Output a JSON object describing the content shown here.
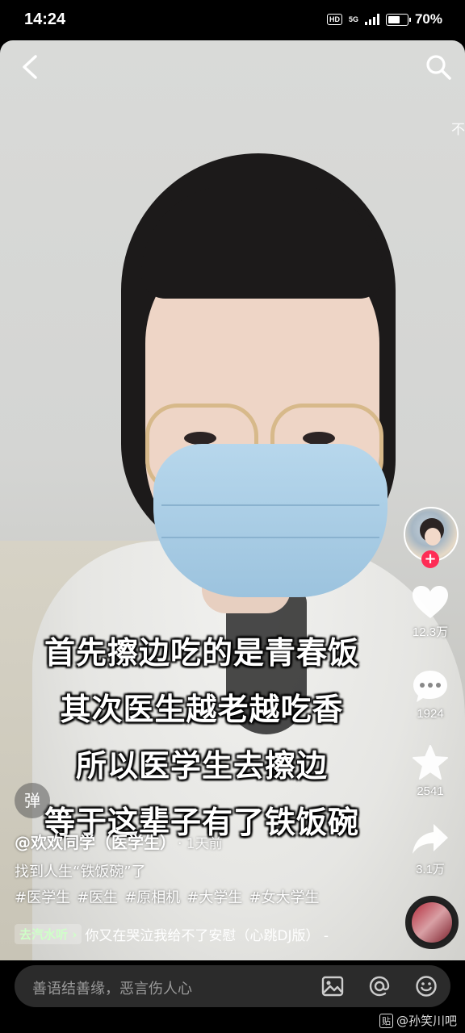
{
  "status_bar": {
    "time": "14:24",
    "hd": "HD",
    "network": "5G",
    "battery_percent": "70%",
    "battery_level": 0.7
  },
  "nav": {
    "back_icon": "back-arrow-icon",
    "search_icon": "search-icon",
    "side_hint": "不"
  },
  "subtitles": [
    "首先擦边吃的是青春饭",
    "其次医生越老越吃香",
    "所以医学生去擦边",
    "等于这辈子有了铁饭碗"
  ],
  "rail": {
    "follow_symbol": "+",
    "likes": "12.3万",
    "comments": "1924",
    "favorites": "2541",
    "shares": "3.1万"
  },
  "info": {
    "danmu_label": "弹",
    "author": "@欢欢同学（医学生）",
    "time_ago": "· 1天前",
    "description": "找到人生“铁饭碗”了",
    "tags": [
      "#医学生",
      "#医生",
      "#原相机",
      "#大学生",
      "#女大学生"
    ],
    "qishui_button": "去汽水听",
    "song": "你又在哭泣我给不了安慰（心跳DJ版） -"
  },
  "comment_bar": {
    "placeholder": "善语结善缘，恶言伤人心"
  },
  "watermark": {
    "badge": "贴",
    "text": "@孙笑川吧"
  },
  "colors": {
    "follow_red": "#fe2c55",
    "comment_bar_bg": "#2b2b2b"
  }
}
